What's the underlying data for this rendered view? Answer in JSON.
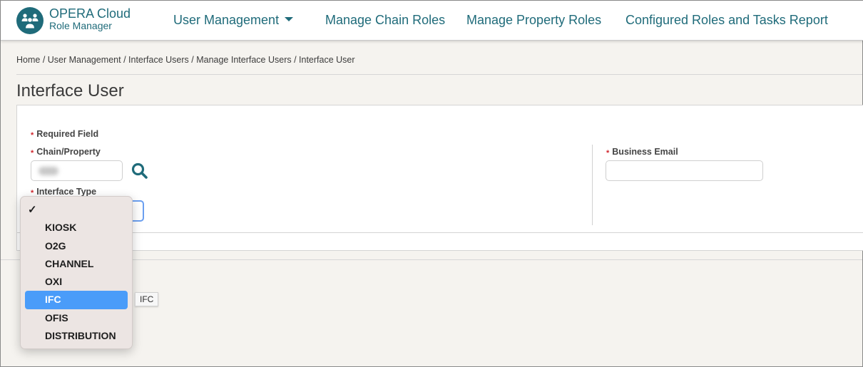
{
  "header": {
    "brand_title": "OPERA Cloud",
    "brand_subtitle": "Role Manager",
    "logo_icon": "users-group-icon",
    "nav": [
      {
        "label": "User Management",
        "has_dropdown": true
      },
      {
        "label": "Manage Chain Roles"
      },
      {
        "label": "Manage Property Roles"
      },
      {
        "label": "Configured Roles and Tasks Report"
      }
    ]
  },
  "breadcrumb": [
    "Home",
    "User Management",
    "Interface Users",
    "Manage Interface Users",
    "Interface User"
  ],
  "breadcrumb_separator": " / ",
  "page_title": "Interface User",
  "form": {
    "required_note": "Required Field",
    "required_marker": "*",
    "chain_property": {
      "label": "Chain/Property",
      "value": "",
      "value_obscured": true,
      "search_icon": "search-icon"
    },
    "interface_type": {
      "label": "Interface Type",
      "selected": ""
    },
    "business_email": {
      "label": "Business Email",
      "value": ""
    }
  },
  "dropdown": {
    "checkmark": "✓",
    "options": [
      "",
      "KIOSK",
      "O2G",
      "CHANNEL",
      "OXI",
      "IFC",
      "OFIS",
      "DISTRIBUTION"
    ],
    "checked_index": 0,
    "highlighted_index": 5
  },
  "tooltip": "IFC",
  "colors": {
    "brand": "#1f6b7a",
    "required": "#d0262d",
    "highlight": "#4a9cf9",
    "focus": "#6b9ff0"
  }
}
